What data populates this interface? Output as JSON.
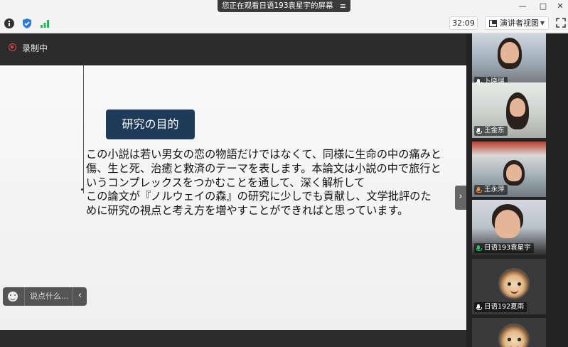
{
  "window": {
    "share_status": "您正在观看日语193袁星宇的屏幕",
    "menu_icon": "≡",
    "minimize": "—",
    "maximize": "□",
    "close": "✕"
  },
  "toolbar": {
    "timer": "32:09",
    "view_mode": "演讲者视图",
    "icons": [
      "info-icon",
      "shield-icon",
      "signal-icon",
      "fullscreen-icon"
    ]
  },
  "recording": {
    "label": "录制中",
    "color": "#e04848"
  },
  "slide": {
    "title": "研究の目的",
    "body": [
      "この小説は若い男女の恋の物語だけではなくて、同様に生命の中の痛みと傷、生と死、治癒と救済のテーマを表します。本論文は小説の中で旅行というコンプレックスをつかむことを通して、深く解析して",
      "この論文が『ノルウェイの森』の研究に少しでも貢献し、文学批評のために研究の視点と考え方を増やすことができればと思っています。"
    ],
    "title_bg": "#1f3b5a"
  },
  "chat": {
    "placeholder": "说点什么...",
    "collapse": "‹"
  },
  "side_toggle": "›",
  "participants": [
    {
      "name": "卜晓瑞",
      "mic": "white"
    },
    {
      "name": "王金东",
      "mic": "white"
    },
    {
      "name": "王永萍",
      "mic": "orange"
    },
    {
      "name": "日语193袁星宇",
      "mic": "green"
    },
    {
      "name": "日语192夏雨",
      "mic": "white"
    },
    {
      "name": "",
      "mic": "white"
    }
  ]
}
